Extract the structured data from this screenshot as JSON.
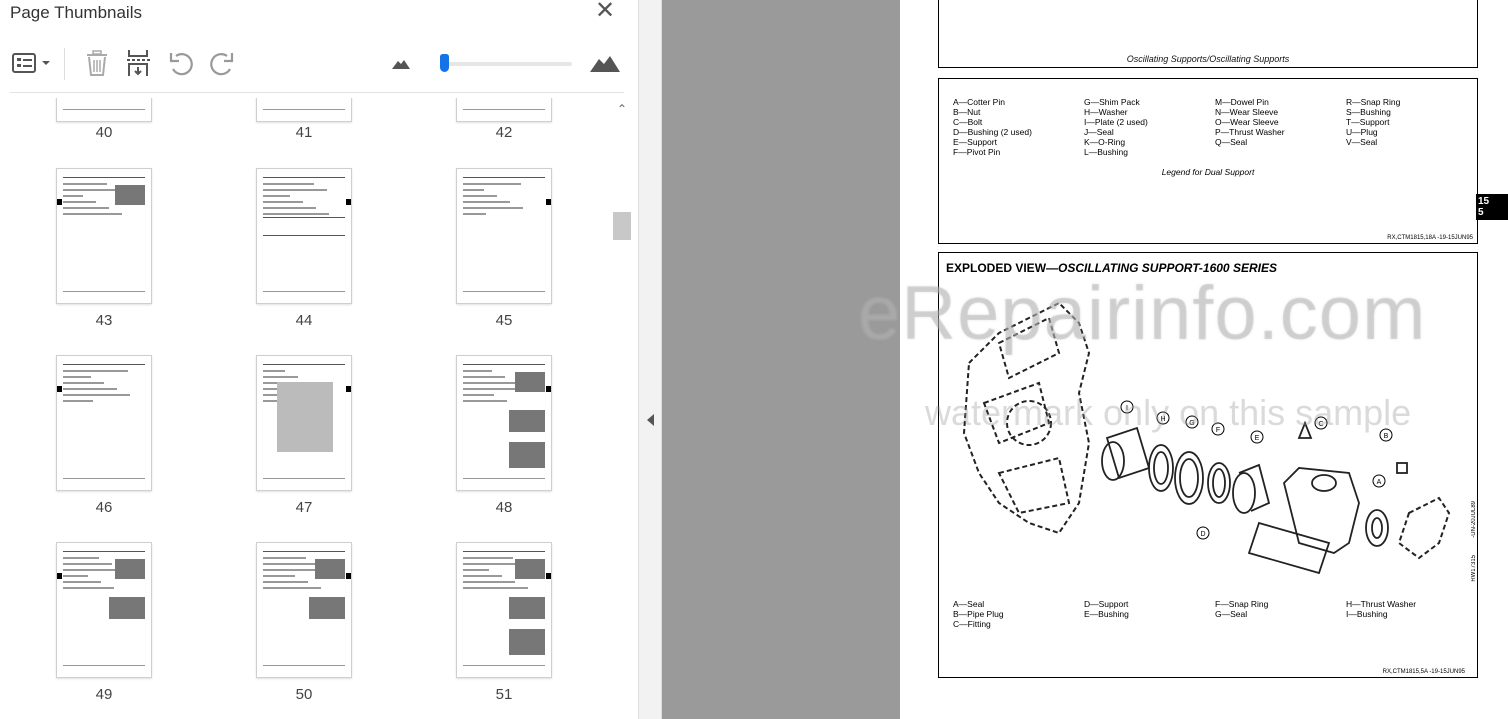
{
  "panel": {
    "title": "Page Thumbnails",
    "close_icon": "close-icon",
    "zoom_level": 0.02
  },
  "toolbar": {
    "options_icon": "thumbnail-options-icon",
    "delete_icon": "trash-icon",
    "insert_icon": "insert-pages-icon",
    "rotate_ccw_icon": "rotate-counterclockwise-icon",
    "rotate_cw_icon": "rotate-clockwise-icon",
    "zoom_out_icon": "small-mountain-icon",
    "zoom_in_icon": "large-mountain-icon"
  },
  "thumbnails": [
    {
      "page": "40"
    },
    {
      "page": "41"
    },
    {
      "page": "42"
    },
    {
      "page": "43"
    },
    {
      "page": "44"
    },
    {
      "page": "45"
    },
    {
      "page": "46"
    },
    {
      "page": "47"
    },
    {
      "page": "48"
    },
    {
      "page": "49"
    },
    {
      "page": "50"
    },
    {
      "page": "51"
    }
  ],
  "document": {
    "header_caption": "Oscillating Supports/Oscillating Supports",
    "legend_dual": {
      "col1": [
        "A—Cotter Pin",
        "B—Nut",
        "C—Bolt",
        "D—Bushing (2 used)",
        "E—Support",
        "F—Pivot Pin"
      ],
      "col2": [
        "G—Shim Pack",
        "H—Washer",
        "I—Plate (2 used)",
        "J—Seal",
        "K—O-Ring",
        "L—Bushing"
      ],
      "col3": [
        "M—Dowel Pin",
        "N—Wear Sleeve",
        "O—Wear Sleeve",
        "P—Thrust Washer",
        "Q—Seal"
      ],
      "col4": [
        "R—Snap Ring",
        "S—Bushing",
        "T—Support",
        "U—Plug",
        "V—Seal"
      ],
      "caption": "Legend for Dual Support",
      "ref": "RX,CTM1815,18A -19-15JUN95"
    },
    "section_tab": [
      "15",
      "5"
    ],
    "exploded": {
      "title_plain": "EXPLODED VIEW—",
      "title_italic": "OSCILLATING SUPPORT-1600 SERIES",
      "side_codes": [
        "-UN-20JUL89",
        "RW17315"
      ],
      "callouts": [
        "I",
        "H",
        "G",
        "F",
        "E",
        "C",
        "B",
        "A",
        "D"
      ],
      "col1": [
        "A—Seal",
        "B—Pipe Plug",
        "C—Fitting"
      ],
      "col2": [
        "D—Support",
        "E—Bushing"
      ],
      "col3": [
        "F—Snap Ring",
        "G—Seal"
      ],
      "col4": [
        "H—Thrust Washer",
        "I—Bushing"
      ],
      "ref": "RX,CTM1815,5A -19-15JUN95"
    }
  },
  "watermark": {
    "line1": "eRepairinfo.com",
    "line2": "watermark only on this sample"
  }
}
